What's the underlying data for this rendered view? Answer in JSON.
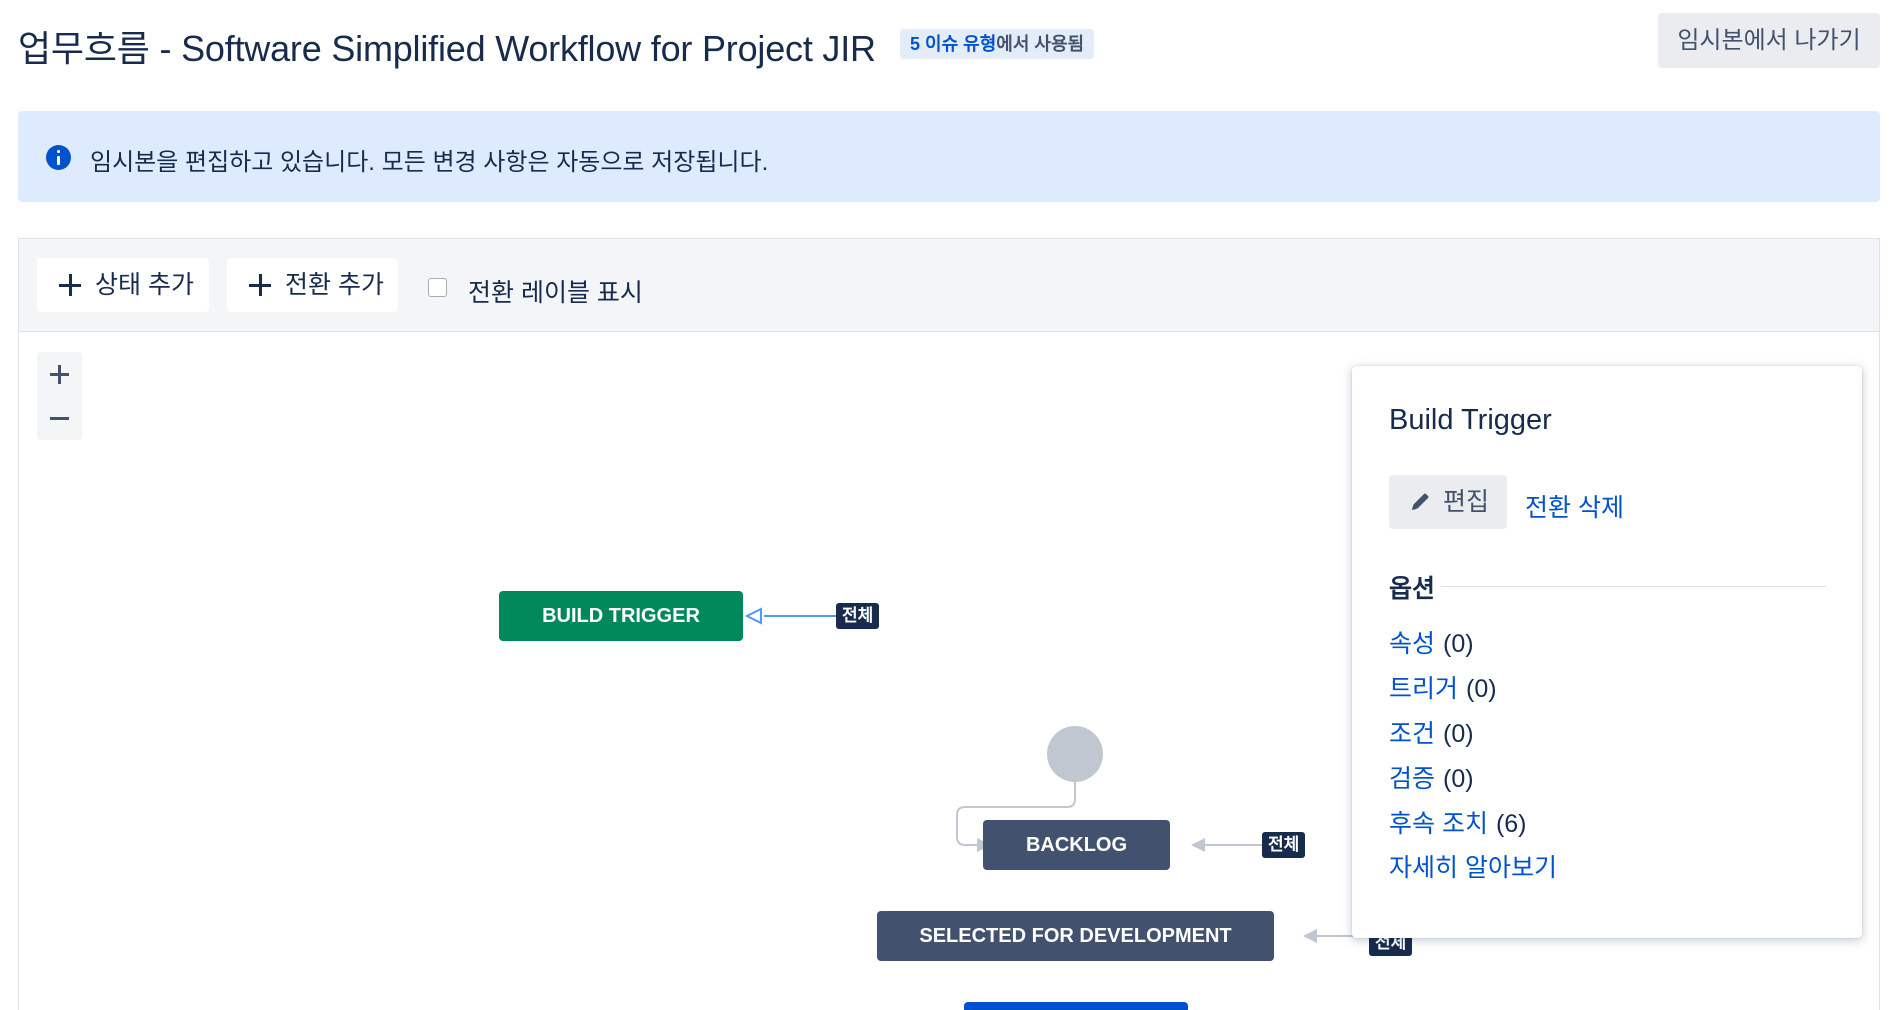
{
  "header": {
    "title": "업무흐름 - Software Simplified Workflow for Project JIR",
    "usage_count_link": "5 이슈 유형",
    "usage_suffix": "에서 사용됨",
    "exit_draft_label": "임시본에서 나가기"
  },
  "banner": {
    "icon": "info-icon",
    "message": "임시본을 편집하고 있습니다. 모든 변경 사항은 자동으로 저장됩니다."
  },
  "toolbar": {
    "add_status_label": "상태 추가",
    "add_transition_label": "전환 추가",
    "show_transition_labels_label": "전환 레이블 표시",
    "show_transition_labels_checked": false
  },
  "diagram": {
    "statuses": [
      {
        "label": "BUILD TRIGGER",
        "color": "#00875a",
        "selected": true
      },
      {
        "label": "BACKLOG",
        "color": "#42526e"
      },
      {
        "label": "SELECTED FOR DEVELOPMENT",
        "color": "#42526e"
      },
      {
        "label": "",
        "color": "#0052cc"
      }
    ],
    "global_transition_tag": "전체"
  },
  "side_panel": {
    "title": "Build Trigger",
    "edit_label": "편집",
    "delete_transition_label": "전환 삭제",
    "options_heading": "옵션",
    "options": [
      {
        "label": "속성",
        "count": "(0)"
      },
      {
        "label": "트리거",
        "count": "(0)"
      },
      {
        "label": "조건",
        "count": "(0)"
      },
      {
        "label": "검증",
        "count": "(0)"
      },
      {
        "label": "후속 조치",
        "count": "(6)"
      }
    ],
    "learn_more_label": "자세히 알아보기"
  },
  "colors": {
    "accent": "#0052cc",
    "banner_background": "#deebff",
    "status_green": "#00875a",
    "status_navy": "#42526e",
    "text_primary": "#172b4d"
  }
}
